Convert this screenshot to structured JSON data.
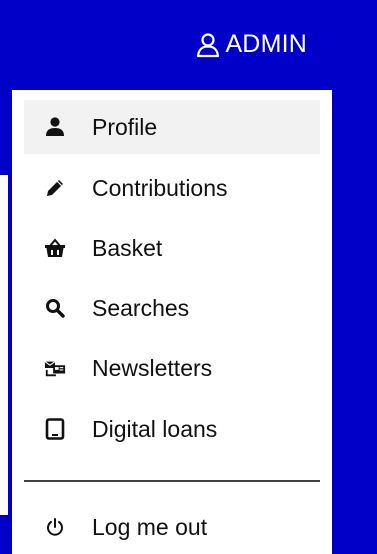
{
  "header": {
    "user_label": "ADMIN",
    "user_icon": "user-outline-icon"
  },
  "menu": {
    "items": [
      {
        "label": "Profile",
        "icon": "user-icon",
        "active": true
      },
      {
        "label": "Contributions",
        "icon": "pencil-icon"
      },
      {
        "label": "Basket",
        "icon": "basket-icon"
      },
      {
        "label": "Searches",
        "icon": "search-icon"
      },
      {
        "label": "Newsletters",
        "icon": "newsletter-icon"
      },
      {
        "label": "Digital loans",
        "icon": "tablet-icon"
      }
    ],
    "logout": {
      "label": "Log me out",
      "icon": "power-icon"
    }
  },
  "colors": {
    "header_bg": "#0000c8",
    "active_item_bg": "#f2f2f2",
    "text": "#111111"
  }
}
